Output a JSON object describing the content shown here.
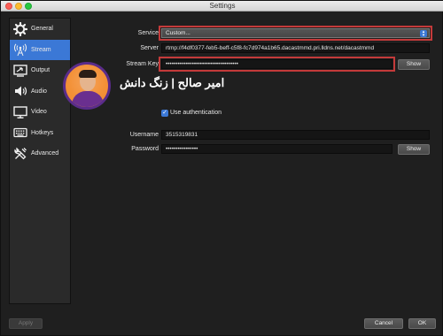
{
  "window": {
    "title": "Settings"
  },
  "sidebar": {
    "items": [
      {
        "label": "General",
        "icon": "gear-icon",
        "active": false
      },
      {
        "label": "Stream",
        "icon": "antenna-icon",
        "active": true
      },
      {
        "label": "Output",
        "icon": "output-icon",
        "active": false
      },
      {
        "label": "Audio",
        "icon": "speaker-icon",
        "active": false
      },
      {
        "label": "Video",
        "icon": "monitor-icon",
        "active": false
      },
      {
        "label": "Hotkeys",
        "icon": "keyboard-icon",
        "active": false
      },
      {
        "label": "Advanced",
        "icon": "tools-icon",
        "active": false
      }
    ]
  },
  "stream": {
    "service_label": "Service",
    "service_value": "Custom...",
    "server_label": "Server",
    "server_value": "rtmp://f4df0377-feb5-beff-c5f8-fc7d974a1b65.dacastmmd.pri.lldns.net/dacastmmd",
    "stream_key_label": "Stream Key",
    "stream_key_value": "••••••••••••••••••••••••••••••••••••",
    "show_label": "Show",
    "use_auth_label": "Use authentication",
    "use_auth_checked": true,
    "username_label": "Username",
    "username_value": "3515319831",
    "password_label": "Password",
    "password_value": "••••••••••••••••",
    "password_show_label": "Show"
  },
  "watermark": {
    "text": "امیر صالح | زنگ دانش"
  },
  "footer": {
    "apply_label": "Apply",
    "cancel_label": "Cancel",
    "ok_label": "OK"
  },
  "colors": {
    "accent": "#3b78d6",
    "highlight": "#c43a3a",
    "background": "#1f1f1f"
  }
}
